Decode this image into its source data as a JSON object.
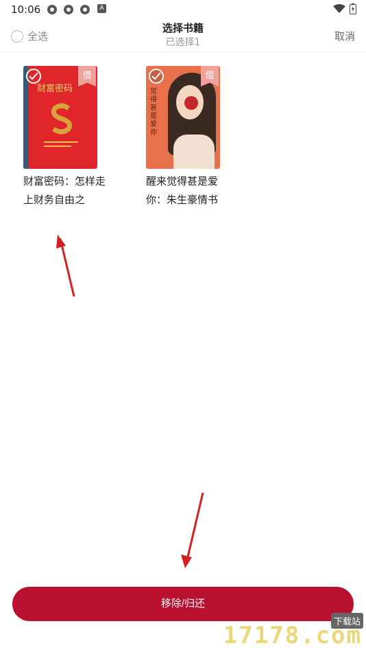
{
  "status_bar": {
    "time": "10:06",
    "app_icon_letter": "A"
  },
  "header": {
    "select_all_label": "全选",
    "title": "选择书籍",
    "subtitle": "已选择1",
    "cancel_label": "取消"
  },
  "books": [
    {
      "title": "财富密码：怎样走上财务自由之",
      "cover_title": "财富密码",
      "badge": "借",
      "selected": true,
      "cover_color": "#e0262b"
    },
    {
      "title": "醒来觉得甚是爱你：朱生豪情书",
      "cover_title": "觉得 甚是爱你",
      "badge": "借",
      "selected": true,
      "cover_color": "#e8704a"
    }
  ],
  "footer": {
    "remove_button_label": "移除/归还"
  },
  "watermark": {
    "text": "17178.com",
    "tag": "下载站"
  },
  "colors": {
    "accent": "#b8102e",
    "badge": "#f0a29a"
  }
}
